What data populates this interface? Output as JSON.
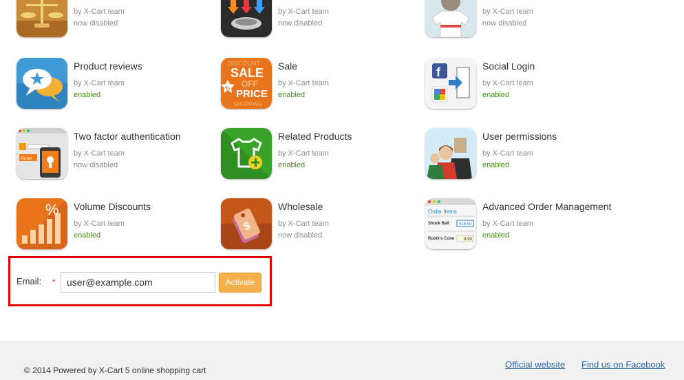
{
  "modules": [
    {
      "name": "",
      "author": "by X-Cart team",
      "status": "now disabled",
      "icon": "scales-icon"
    },
    {
      "name": "",
      "author": "by X-Cart team",
      "status": "now disabled",
      "icon": "filter-arrows-icon"
    },
    {
      "name": "",
      "author": "by X-Cart team",
      "status": "now disabled",
      "icon": "tshirt-icon"
    },
    {
      "name": "Product reviews",
      "author": "by X-Cart team",
      "status": "enabled",
      "icon": "speech-bubbles-star-icon"
    },
    {
      "name": "Sale",
      "author": "by X-Cart team",
      "status": "enabled",
      "icon": "sale-price-tag-icon"
    },
    {
      "name": "Social Login",
      "author": "by X-Cart team",
      "status": "enabled",
      "icon": "social-login-icon"
    },
    {
      "name": "Two factor authentication",
      "author": "by X-Cart team",
      "status": "now disabled",
      "icon": "two-factor-auth-icon"
    },
    {
      "name": "Related Products",
      "author": "by X-Cart team",
      "status": "enabled",
      "icon": "related-products-shirt-icon"
    },
    {
      "name": "User permissions",
      "author": "by X-Cart team",
      "status": "enabled",
      "icon": "user-permissions-people-icon"
    },
    {
      "name": "Volume Discounts",
      "author": "by X-Cart team",
      "status": "enabled",
      "icon": "volume-discount-bars-icon"
    },
    {
      "name": "Wholesale",
      "author": "by X-Cart team",
      "status": "now disabled",
      "icon": "wholesale-tags-icon"
    },
    {
      "name": "Advanced Order Management",
      "author": "by X-Cart team",
      "status": "enabled",
      "icon": "order-items-icon"
    }
  ],
  "icon_text": {
    "sale_lines": [
      "DISCOUNT",
      "SALE",
      "OFF",
      "PRICE",
      "SHOPPING"
    ],
    "sale_percent": "%",
    "volume_percent": "%",
    "twofa_label": "Autor",
    "order_title": "Order items",
    "order_item1": "Shock Ball",
    "order_item2": "Rubik's Cube",
    "order_price1": "$15.99",
    "order_price2": "9.99"
  },
  "activation": {
    "label": "Email:",
    "required_mark": "*",
    "email_value": "user@example.com",
    "button_label": "Activate"
  },
  "footer": {
    "copyright": "© 2014 Powered by X-Cart 5 online shopping cart",
    "link_official": "Official website",
    "link_facebook": "Find us on Facebook"
  },
  "colors": {
    "enabled": "#4a8a1c",
    "disabled": "#8c8c8c",
    "button": "#f3b04b",
    "highlight_border": "#e00000",
    "link": "#2b6aa6"
  }
}
